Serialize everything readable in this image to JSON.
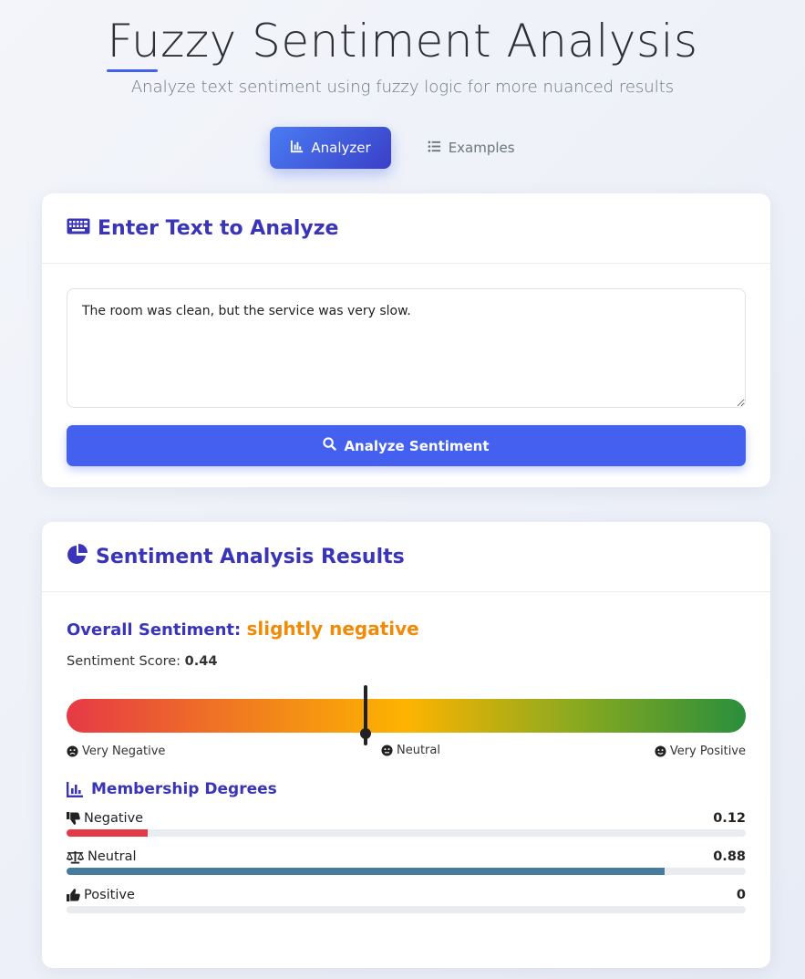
{
  "header": {
    "title": "Fuzzy Sentiment Analysis",
    "subtitle": "Analyze text sentiment using fuzzy logic for more nuanced results"
  },
  "tabs": [
    {
      "label": "Analyzer",
      "icon": "chart-bar-icon",
      "active": true
    },
    {
      "label": "Examples",
      "icon": "list-icon",
      "active": false
    }
  ],
  "input_card": {
    "title": "Enter Text to Analyze",
    "icon": "keyboard-icon",
    "textarea_value": "The room was clean, but the service was very slow.",
    "button_label": "Analyze Sentiment",
    "button_icon": "search-icon"
  },
  "results_card": {
    "title": "Sentiment Analysis Results",
    "icon": "pie-chart-icon",
    "overall_label": "Overall Sentiment:",
    "overall_value": "slightly negative",
    "score_label": "Sentiment Score:",
    "score_value": "0.44",
    "score_numeric": 0.44,
    "gauge_labels": {
      "left": "Very Negative",
      "middle": "Neutral",
      "right": "Very Positive"
    },
    "membership_title": "Membership Degrees",
    "memberships": [
      {
        "label": "Negative",
        "icon": "thumbs-down-icon",
        "value": "0.12",
        "fraction": 0.12,
        "color": "#e63946"
      },
      {
        "label": "Neutral",
        "icon": "balance-scale-icon",
        "value": "0.88",
        "fraction": 0.88,
        "color": "#457b9d"
      },
      {
        "label": "Positive",
        "icon": "thumbs-up-icon",
        "value": "0",
        "fraction": 0,
        "color": "#2a9d8f"
      }
    ]
  },
  "colors": {
    "accent": "#4361ee",
    "heading": "#3a34b8",
    "sentiment_value": "#f08a07"
  }
}
